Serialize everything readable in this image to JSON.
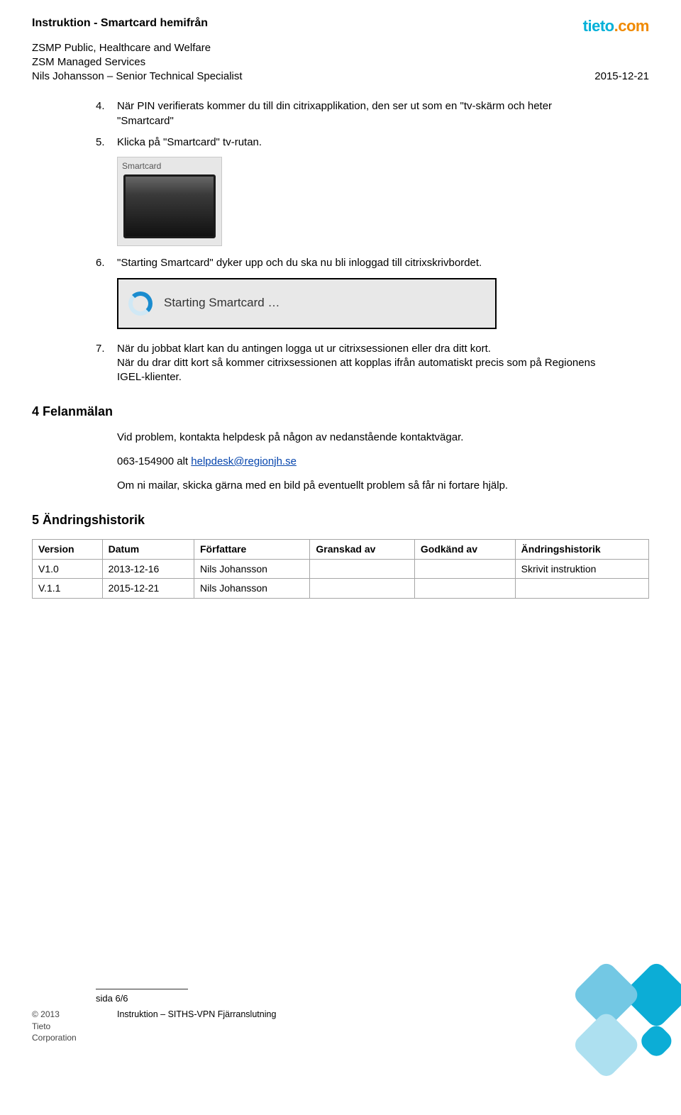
{
  "header": {
    "title": "Instruktion - Smartcard hemifrån",
    "line1": "ZSMP Public, Healthcare and Welfare",
    "line2": "ZSM Managed Services",
    "line3": "Nils Johansson – Senior Technical Specialist",
    "date": "2015-12-21"
  },
  "logo": {
    "tieto": "tieto",
    "dot": ".",
    "com": "com"
  },
  "steps": {
    "s4_num": "4.",
    "s4_text": "När PIN verifierats kommer du till din citrixapplikation, den ser ut som en \"tv-skärm och heter \"Smartcard\"",
    "s5_num": "5.",
    "s5_text": "Klicka på \"Smartcard\" tv-rutan.",
    "smartcard_label": "Smartcard",
    "s6_num": "6.",
    "s6_text": "\"Starting Smartcard\" dyker upp och du ska nu bli inloggad till citrixskrivbordet.",
    "starting_text": "Starting Smartcard …",
    "s7_num": "7.",
    "s7_text_a": "När du jobbat klart kan du antingen logga ut ur citrixsessionen eller dra ditt kort.",
    "s7_text_b": "När du drar ditt kort så kommer citrixsessionen att kopplas ifrån automatiskt precis som på Regionens IGEL-klienter."
  },
  "section4": {
    "heading": "4 Felanmälan",
    "p1": "Vid problem, kontakta helpdesk på någon av nedanstående kontaktvägar.",
    "phone_prefix": "063-154900 alt ",
    "email": "helpdesk@regionjh.se",
    "p3": "Om ni mailar, skicka gärna med en bild på eventuellt problem så får ni fortare hjälp."
  },
  "section5": {
    "heading": "5 Ändringshistorik",
    "cols": [
      "Version",
      "Datum",
      "Författare",
      "Granskad av",
      "Godkänd av",
      "Ändringshistorik"
    ],
    "rows": [
      {
        "version": "V1.0",
        "datum": "2013-12-16",
        "forf": "Nils Johansson",
        "gransk": "",
        "godk": "",
        "hist": "Skrivit instruktion"
      },
      {
        "version": "V.1.1",
        "datum": "2015-12-21",
        "forf": "Nils Johansson",
        "gransk": "",
        "godk": "",
        "hist": ""
      }
    ]
  },
  "footer": {
    "page": "sida 6/6",
    "copyright": "© 2013",
    "corp": "Tieto Corporation",
    "doc": "Instruktion – SITHS-VPN Fjärranslutning"
  }
}
